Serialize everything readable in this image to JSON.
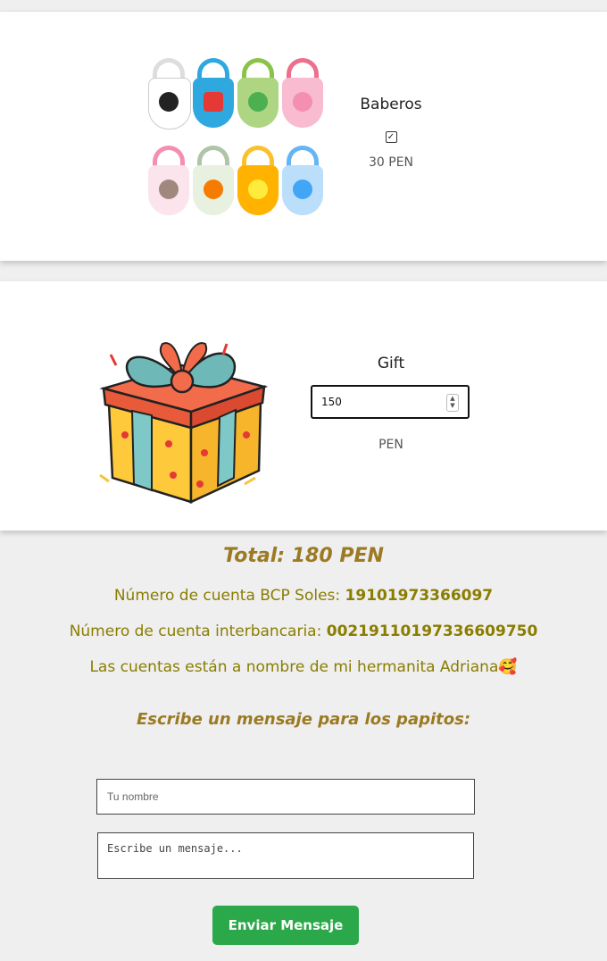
{
  "items": [
    {
      "name": "Baberos",
      "price": "30 PEN",
      "checked": true,
      "image": "bibs-image"
    },
    {
      "name": "Gift",
      "amount": "150",
      "currency": "PEN",
      "image": "gift-box-image"
    }
  ],
  "summary": {
    "total": "Total: 180 PEN",
    "bcp_label": "Número de cuenta BCP Soles: ",
    "bcp_value": "19101973366097",
    "interbank_label": "Número de cuenta interbancaria: ",
    "interbank_value": "00219110197336609750",
    "note": "Las cuentas están a nombre de mi hermanita Adriana",
    "note_emoji": "🥰"
  },
  "form": {
    "title": "Escribe un mensaje para los papitos:",
    "name_placeholder": "Tu nombre",
    "message_placeholder": "Escribe un mensaje...",
    "submit_label": "Enviar Mensaje"
  },
  "colors": {
    "accent_gold": "#9b7a22",
    "olive_text": "#8a7d00",
    "button_green": "#2aa84a"
  }
}
